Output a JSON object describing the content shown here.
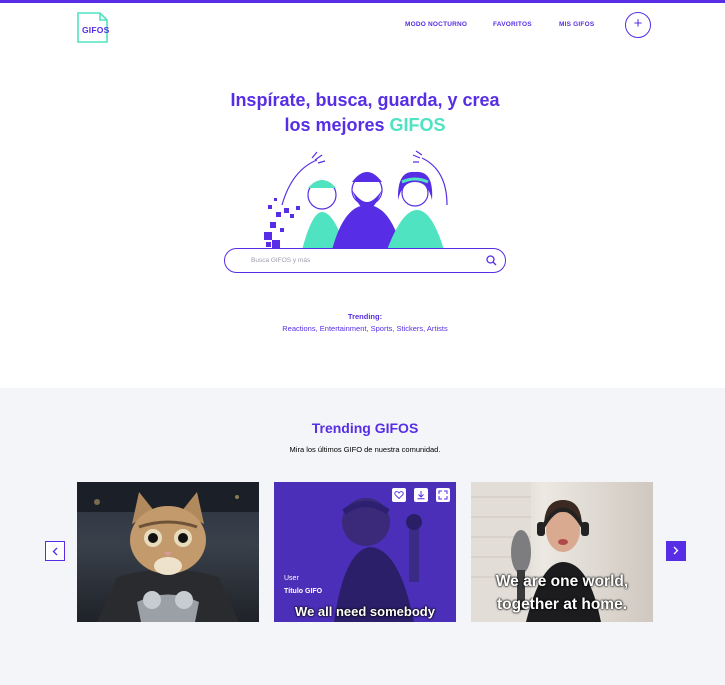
{
  "header": {
    "logo_text": "GIFOS",
    "nav": {
      "night_mode": "MODO NOCTURNO",
      "favorites": "FAVORITOS",
      "my_gifos": "MIS GIFOS"
    },
    "create_icon": "plus-icon"
  },
  "hero": {
    "title_line1": "Inspírate, busca, guarda, y crea",
    "title_line2_prefix": "los mejores",
    "title_line2_accent": "GIFOS"
  },
  "search": {
    "placeholder": "Busca GIFOS y más",
    "icon": "search-icon"
  },
  "trending_terms": {
    "label": "Trending:",
    "terms": "Reactions, Entertainment, Sports, Stickers, Artists"
  },
  "trending_gifos": {
    "title": "Trending GIFOS",
    "subtitle": "Mira los últimos GIFO de nuestra comunidad.",
    "cards": [
      {
        "caption": ""
      },
      {
        "user": "User",
        "title": "Título GIFO",
        "caption": "We all need somebody"
      },
      {
        "caption_line1": "We are one world,",
        "caption_line2": "together at home."
      }
    ]
  },
  "colors": {
    "brand": "#572ee5",
    "accent": "#50e3c2",
    "section_bg": "#f3f5f8"
  }
}
